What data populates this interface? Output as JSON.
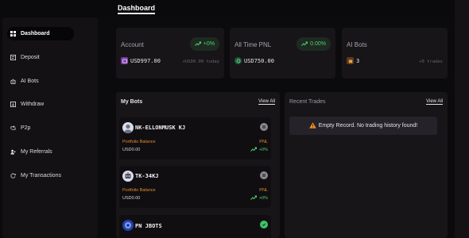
{
  "header": {
    "title": "Dashboard"
  },
  "sidebar": {
    "items": [
      {
        "label": "Dashboard",
        "icon": "grid-icon",
        "active": true
      },
      {
        "label": "Deposit",
        "icon": "deposit-icon"
      },
      {
        "label": "AI Bots",
        "icon": "robot-icon"
      },
      {
        "label": "Withdraw",
        "icon": "withdraw-icon"
      },
      {
        "label": "P2p",
        "icon": "p2p-icon"
      },
      {
        "label": "My Referrals",
        "icon": "referrals-icon"
      },
      {
        "label": "My Transactions",
        "icon": "transactions-icon"
      }
    ]
  },
  "stats": {
    "account": {
      "title": "Account",
      "badge": "+0%",
      "value": "USD997.00",
      "sub": "+USD0.00 today"
    },
    "pnl": {
      "title": "All Time PNL",
      "badge": "0.00%",
      "value": "USD750.00"
    },
    "bots": {
      "title": "AI Bots",
      "value": "3",
      "sub": "+0 trades"
    }
  },
  "my_bots": {
    "title": "My Bots",
    "view_all": "View All",
    "items": [
      {
        "name": "NK-ELLONMUSK KJ",
        "balance_label": "Portfolio Balance",
        "balance": "USD0.00",
        "pnl_label": "PNL",
        "pnl": "+0%",
        "status": "paused"
      },
      {
        "name": "TK-34KJ",
        "balance_label": "Portfolio Balance",
        "balance": "USD0.00",
        "pnl_label": "PNL",
        "pnl": "+0%",
        "status": "paused"
      },
      {
        "name": "PN JBOTS",
        "status": "active"
      }
    ]
  },
  "recent_trades": {
    "title": "Recent Trades",
    "view_all": "View All",
    "empty": "Empty Record. No trading history found!"
  },
  "colors": {
    "accent_green": "#4fd173",
    "label_orange": "#e88b2e",
    "warning_orange": "#f08a24",
    "background": "#0b0a0c",
    "card": "#171518"
  }
}
